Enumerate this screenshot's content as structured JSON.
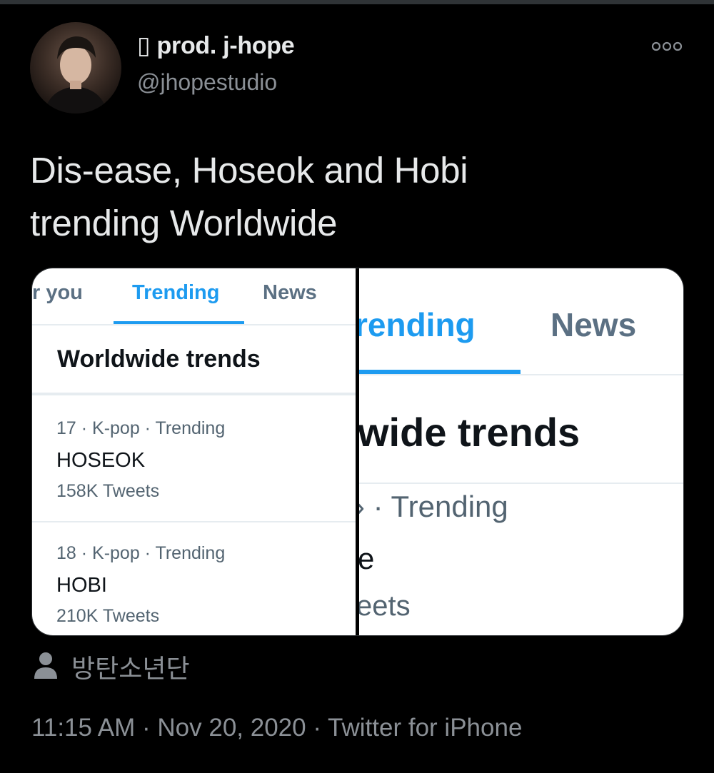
{
  "tweet": {
    "display_name": "▯ prod. j-hope",
    "handle": "@jhopestudio",
    "text_line1": "Dis-ease, Hoseok and Hobi",
    "text_line2": "trending Worldwide",
    "location": "방탄소년단",
    "timestamp": "11:15 AM · Nov 20, 2020 · Twitter for iPhone"
  },
  "media": {
    "left": {
      "tabs": [
        "r you",
        "Trending",
        "News"
      ],
      "section_title": "Worldwide trends",
      "trends": [
        {
          "meta": "17 · K-pop · Trending",
          "name": "HOSEOK",
          "count": "158K Tweets"
        },
        {
          "meta": "18 · K-pop · Trending",
          "name": "HOBI",
          "count": "210K Tweets"
        }
      ]
    },
    "right": {
      "tabs": [
        "rending",
        "News"
      ],
      "section_title": "wide trends",
      "trend_meta": "› · Trending",
      "trend_name": "e",
      "trend_count": "eets"
    }
  },
  "icons": {
    "more": "more-dots-icon",
    "person": "person-icon"
  },
  "colors": {
    "background": "#000000",
    "text_primary": "#e7e9ea",
    "text_secondary": "#8b9096",
    "accent": "#1d9bf0"
  }
}
